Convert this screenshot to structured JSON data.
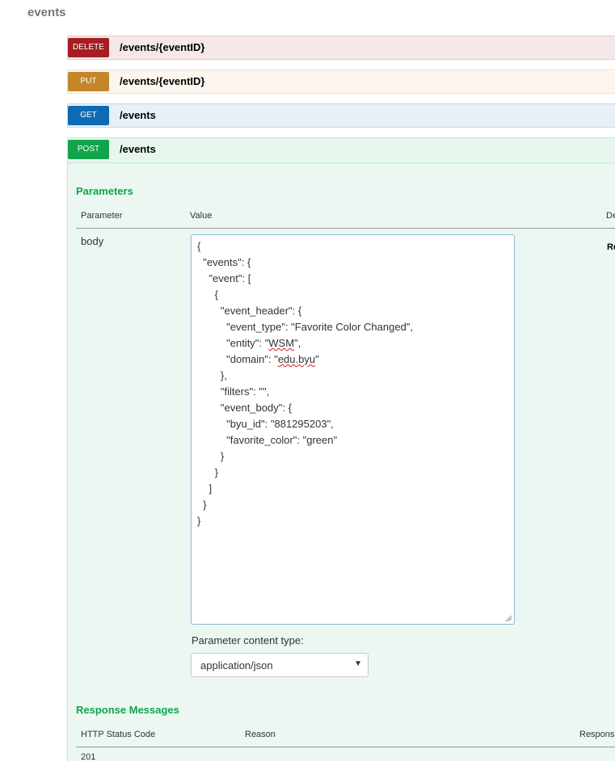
{
  "section": {
    "title": "events"
  },
  "operations": [
    {
      "method": "DELETE",
      "path": "/events/{eventID}"
    },
    {
      "method": "PUT",
      "path": "/events/{eventID}"
    },
    {
      "method": "GET",
      "path": "/events"
    },
    {
      "method": "POST",
      "path": "/events"
    }
  ],
  "parameters": {
    "title": "Parameters",
    "headers": {
      "parameter": "Parameter",
      "value": "Value",
      "description": "De"
    },
    "row": {
      "name": "body",
      "description": "Re"
    },
    "body_lines": [
      "{",
      "  \"events\": {",
      "    \"event\": [",
      "      {",
      "        \"event_header\": {",
      "          \"event_type\": \"Favorite Color Changed\",",
      "          \"entity\": \"WSM\",",
      "          \"domain\": \"edu.byu\"",
      "        },",
      "        \"filters\": \"\",",
      "        \"event_body\": {",
      "          \"byu_id\": \"881295203\",",
      "          \"favorite_color\": \"green\"",
      "        }",
      "      }",
      "    ]",
      "  }",
      "}"
    ],
    "content_type_label": "Parameter content type:",
    "content_type_value": "application/json"
  },
  "responses": {
    "title": "Response Messages",
    "headers": {
      "code": "HTTP Status Code",
      "reason": "Reason",
      "response": "Response"
    },
    "first_code": "201"
  },
  "colors": {
    "delete": "#a41e22",
    "put": "#c5862b",
    "get": "#0f6ab4",
    "post": "#10a54a"
  }
}
